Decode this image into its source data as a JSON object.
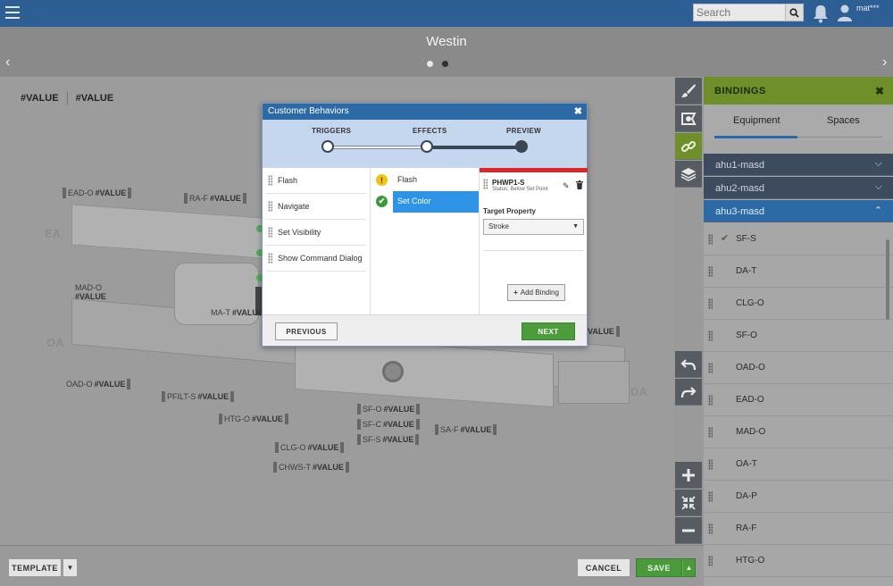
{
  "topbar": {
    "search_placeholder": "Search",
    "username": "mat***",
    "icons": [
      "menu-icon",
      "search-icon",
      "bell-icon",
      "user-icon"
    ]
  },
  "page": {
    "title": "Westin",
    "pager_dots": 2,
    "active_dot": 1
  },
  "canvas": {
    "header_values": [
      "#VALUE",
      "#VALUE"
    ],
    "side_letters": {
      "ea": "EA",
      "oa": "OA",
      "da": "DA"
    },
    "labels": [
      {
        "id": "ead-o",
        "name": "EAD-O",
        "value": "#VALUE"
      },
      {
        "id": "ra-f",
        "name": "RA-F",
        "value": "#VALUE"
      },
      {
        "id": "mad-o",
        "name": "MAD-O",
        "value": "#VALUE"
      },
      {
        "id": "ma-t",
        "name": "MA-T",
        "value": "#VALUE"
      },
      {
        "id": "oad-o",
        "name": "OAD-O",
        "value": "#VALUE"
      },
      {
        "id": "pfilt-s",
        "name": "PFILT-S",
        "value": "#VALUE"
      },
      {
        "id": "htg-o",
        "name": "HTG-O",
        "value": "#VALUE"
      },
      {
        "id": "clg-o",
        "name": "CLG-O",
        "value": "#VALUE"
      },
      {
        "id": "chws-t",
        "name": "CHWS-T",
        "value": "#VALUE"
      },
      {
        "id": "sf-o",
        "name": "SF-O",
        "value": "#VALUE"
      },
      {
        "id": "sf-c",
        "name": "SF-C",
        "value": "#VALUE"
      },
      {
        "id": "sf-s",
        "name": "SF-S",
        "value": "#VALUE"
      },
      {
        "id": "sa-f",
        "name": "SA-F",
        "value": "#VALUE"
      },
      {
        "id": "right-value",
        "name": "",
        "value": "VALUE"
      }
    ]
  },
  "bottombar": {
    "template_label": "TEMPLATE",
    "cancel_label": "CANCEL",
    "save_label": "SAVE"
  },
  "tools": [
    "brush-icon",
    "shape-icon",
    "link-icon",
    "layers-icon",
    "undo-icon",
    "redo-icon",
    "zoom-in-icon",
    "fit-icon",
    "zoom-out-icon"
  ],
  "bindings": {
    "title": "BINDINGS",
    "tabs": [
      "Equipment",
      "Spaces"
    ],
    "active_tab": "Equipment",
    "groups": [
      "ahu1-masd",
      "ahu2-masd",
      "ahu3-masd"
    ],
    "open_group": "ahu3-masd",
    "points": [
      {
        "label": "SF-S",
        "checked": true
      },
      {
        "label": "DA-T",
        "checked": false
      },
      {
        "label": "CLG-O",
        "checked": false
      },
      {
        "label": "SF-O",
        "checked": false
      },
      {
        "label": "OAD-O",
        "checked": false
      },
      {
        "label": "EAD-O",
        "checked": false
      },
      {
        "label": "MAD-O",
        "checked": false
      },
      {
        "label": "OA-T",
        "checked": false
      },
      {
        "label": "DA-P",
        "checked": false
      },
      {
        "label": "RA-F",
        "checked": false
      },
      {
        "label": "HTG-O",
        "checked": false
      }
    ]
  },
  "modal": {
    "title": "Customer Behaviors",
    "steps": [
      "TRIGGERS",
      "EFFECTS",
      "PREVIEW"
    ],
    "current_step": "EFFECTS",
    "triggers": [
      "Flash",
      "Navigate",
      "Set Visibility",
      "Show Command Dialog"
    ],
    "effects": [
      {
        "label": "Flash",
        "status": "warning"
      },
      {
        "label": "Set Color",
        "status": "ok"
      }
    ],
    "selected_effect": "Set Color",
    "preview": {
      "point_name": "PHWP1-S",
      "point_status": "Status: Below Set Point",
      "target_property_label": "Target Property",
      "target_property_value": "Stroke",
      "add_binding_label": "Add Binding"
    },
    "previous_label": "PREVIOUS",
    "next_label": "NEXT",
    "colors": {
      "header": "#2b6aa4",
      "selected": "#2f94e6",
      "next": "#4c9c3c",
      "alert_bar": "#e02525",
      "warning": "#f1c40f",
      "ok": "#3c9a3a"
    }
  }
}
